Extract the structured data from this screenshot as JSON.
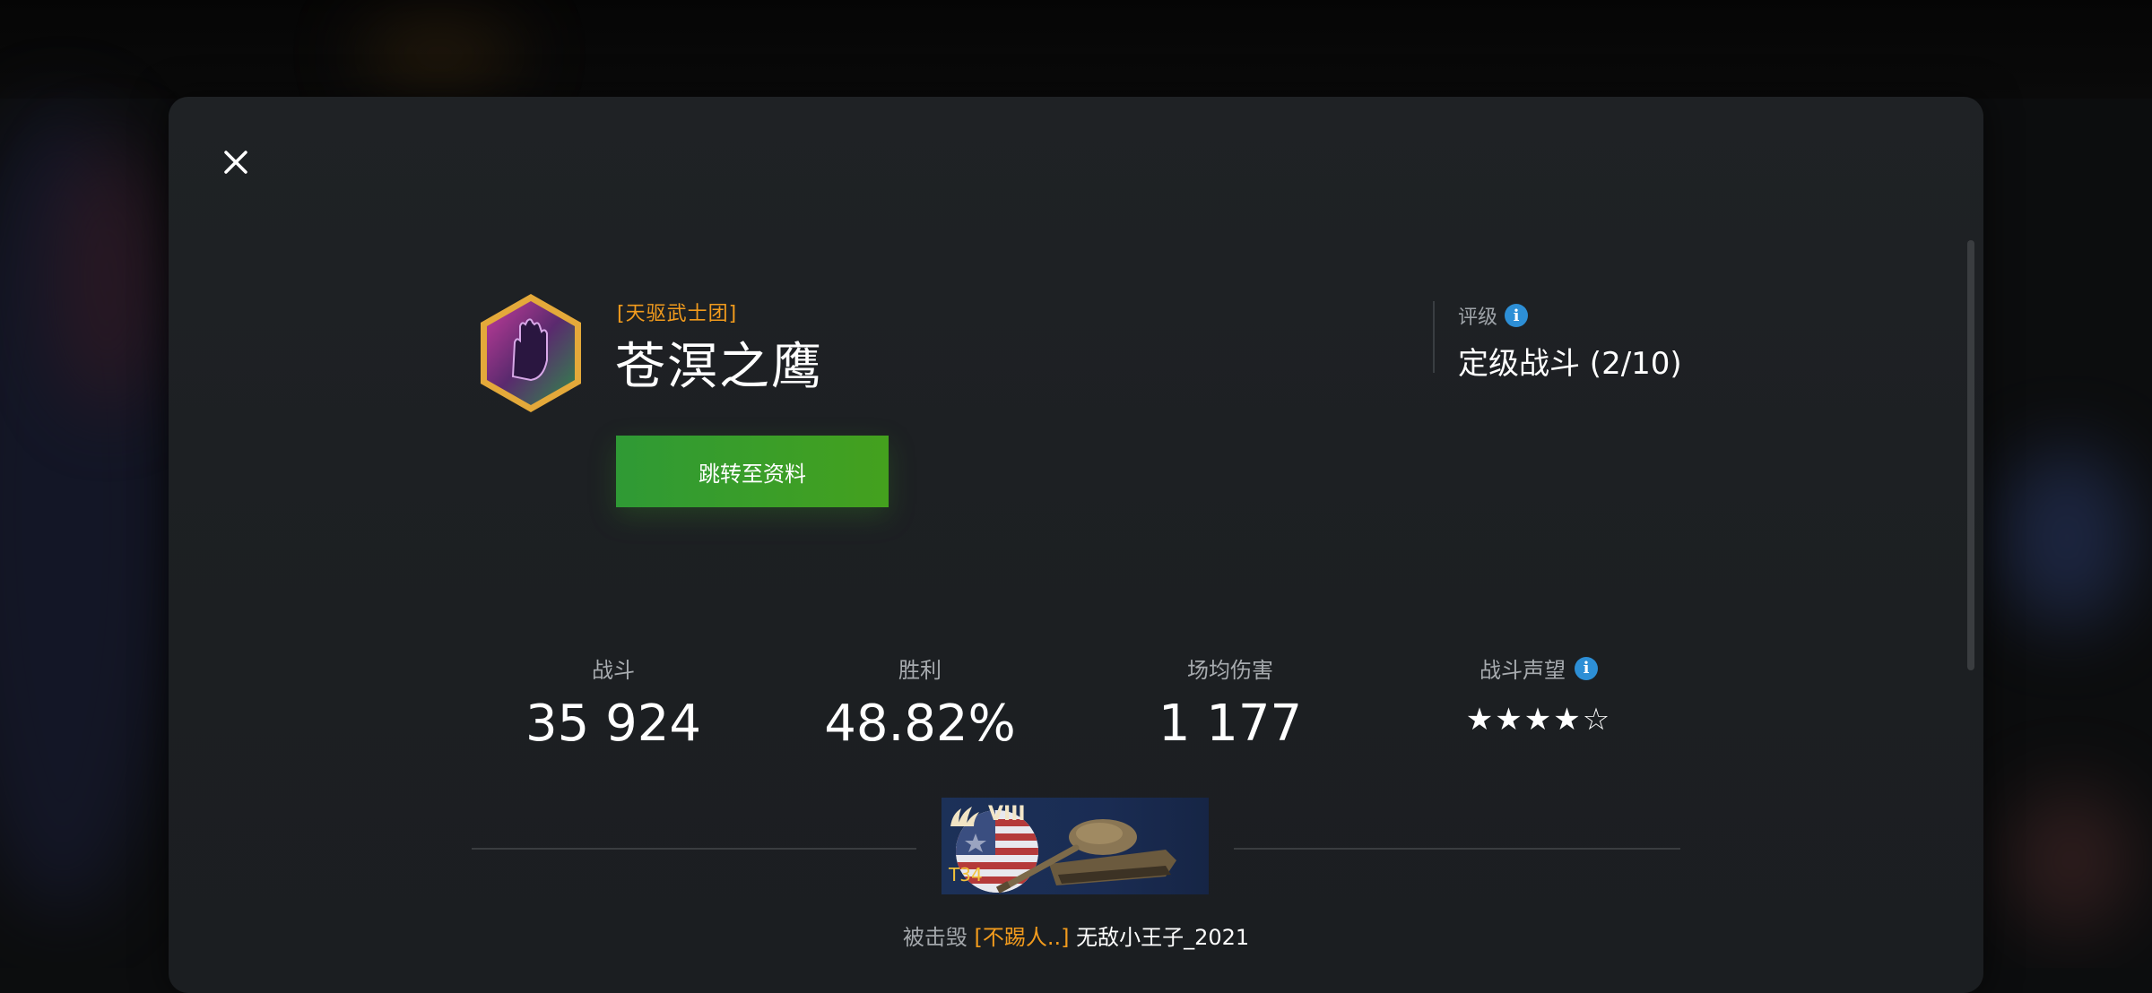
{
  "modal": {
    "clan_tag": "[天驱武士团]",
    "player_name": "苍溟之鹰",
    "profile_button_label": "跳转至资料",
    "rating": {
      "label": "评级",
      "value": "定级战斗 (2/10)"
    }
  },
  "stats": [
    {
      "label": "战斗",
      "value": "35 924"
    },
    {
      "label": "胜利",
      "value": "48.82%"
    },
    {
      "label": "场均伤害",
      "value": "1 177"
    },
    {
      "label": "战斗声望",
      "value": "★★★★☆",
      "stars_filled": 4,
      "stars_total": 5
    }
  ],
  "vehicle": {
    "tier": "VIII",
    "name": "T34"
  },
  "destroyed_by": {
    "prefix": "被击毁",
    "clan": "[不踢人..]",
    "player": "无敌小王子_2021"
  },
  "colors": {
    "accent_orange": "#f29b1d",
    "button_green": "#3a9e2a",
    "info_blue": "#2d8fd6"
  },
  "icons": [
    "close-icon",
    "clan-emblem-icon",
    "info-icon",
    "star-icon",
    "tier-emblem-icon",
    "tank-icon"
  ]
}
